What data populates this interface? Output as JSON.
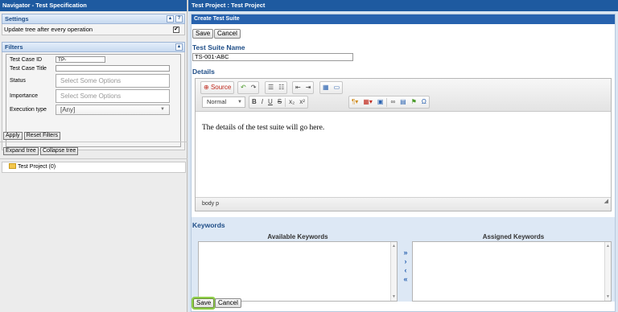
{
  "navigator": {
    "title": "Navigator - Test Specification",
    "settings": {
      "header": "Settings",
      "collapse_glyph": "▲",
      "help_glyph": "?",
      "update_tree_label": "Update tree after every operation",
      "update_tree_checked": "✔"
    },
    "filters": {
      "header": "Filters",
      "collapse_glyph": "▲",
      "test_case_id_label": "Test Case ID",
      "test_case_id_value": "TP-",
      "test_case_title_label": "Test Case Title",
      "test_case_title_value": "",
      "status_label": "Status",
      "status_placeholder": "Select Some Options",
      "importance_label": "Importance",
      "importance_placeholder": "Select Some Options",
      "execution_type_label": "Execution type",
      "execution_type_value": "[Any]",
      "apply_label": "Apply",
      "reset_label": "Reset Filters"
    },
    "tree": {
      "expand_label": "Expand tree",
      "collapse_label": "Collapse tree",
      "root_node": "Test Project (0)"
    }
  },
  "work": {
    "title": "Test Project : Test Project",
    "panel_header": "Create Test Suite",
    "save_label": "Save",
    "cancel_label": "Cancel",
    "name_label": "Test Suite Name",
    "name_value": "TS-001-ABC",
    "details_label": "Details",
    "editor": {
      "source_label": "Source",
      "format_value": "Normal",
      "content": "The details of the test suite will go here.",
      "path": "body  p"
    },
    "keywords": {
      "label": "Keywords",
      "available_title": "Available Keywords",
      "assigned_title": "Assigned Keywords"
    }
  },
  "colors": {
    "titlebar": "#1e5aa0",
    "panel_header": "#2762ae",
    "accent_text": "#1e4d87",
    "save_highlight": "#8fcf4a"
  }
}
